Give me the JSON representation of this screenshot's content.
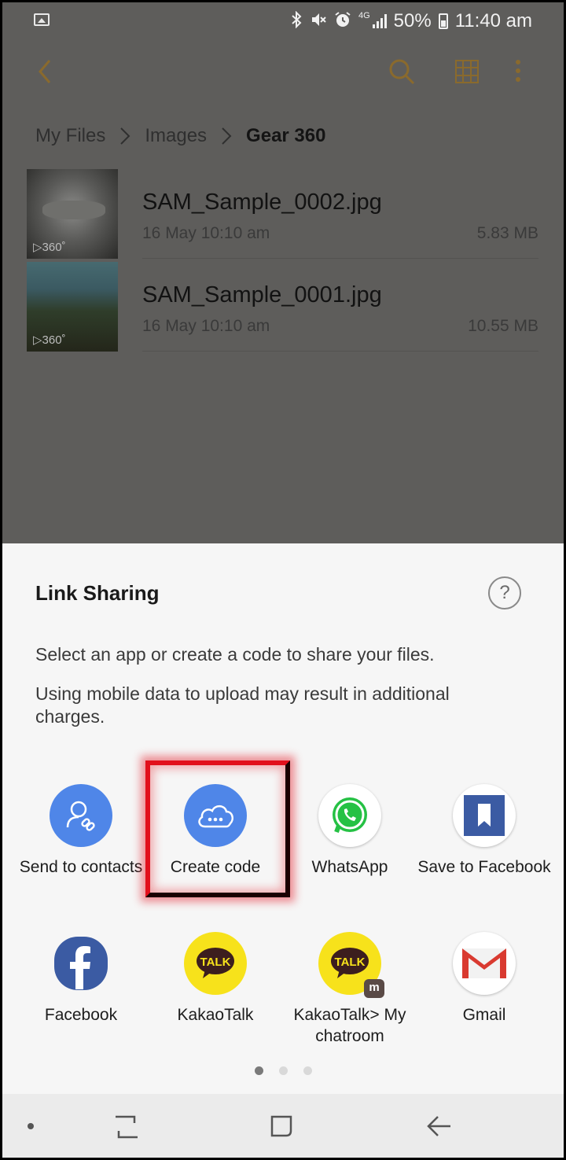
{
  "status_bar": {
    "network_label": "4G",
    "battery": "50%",
    "time": "11:40 am",
    "icons": [
      "gallery-icon",
      "bluetooth-icon",
      "mute-icon",
      "alarm-icon",
      "signal-icon",
      "battery-icon"
    ]
  },
  "app_bar": {
    "icons": [
      "back-arrow-icon",
      "search-icon",
      "grid-view-icon",
      "more-options-icon"
    ],
    "accent_color": "#8a6a2d"
  },
  "breadcrumb": {
    "items": [
      "My Files",
      "Images",
      "Gear 360"
    ]
  },
  "files": [
    {
      "name": "SAM_Sample_0002.jpg",
      "date": "16 May 10:10 am",
      "size": "5.83 MB",
      "badge": "▷360˚"
    },
    {
      "name": "SAM_Sample_0001.jpg",
      "date": "16 May 10:10 am",
      "size": "10.55 MB",
      "badge": "▷360˚"
    }
  ],
  "sheet": {
    "title": "Link Sharing",
    "help_label": "?",
    "description_1": "Select an app or create a code to share your files.",
    "description_2": "Using mobile data to upload may result in additional charges.",
    "apps": [
      {
        "label": "Send to contacts",
        "icon": "contacts-link-icon"
      },
      {
        "label": "Create code",
        "icon": "cloud-code-icon"
      },
      {
        "label": "WhatsApp",
        "icon": "whatsapp-icon"
      },
      {
        "label": "Save to Facebook",
        "icon": "facebook-save-icon"
      },
      {
        "label": "Facebook",
        "icon": "facebook-icon"
      },
      {
        "label": "KakaoTalk",
        "icon": "kakaotalk-icon",
        "icon_text": "TALK"
      },
      {
        "label": "KakaoTalk> My chatroom",
        "icon": "kakaotalk-chatroom-icon",
        "icon_text": "TALK",
        "sub_badge": "m"
      },
      {
        "label": "Gmail",
        "icon": "gmail-icon"
      }
    ],
    "page_dots": {
      "count": 3,
      "active": 0
    }
  },
  "nav_bar": {
    "icons": [
      "dot-icon",
      "recent-apps-icon",
      "home-icon",
      "back-icon"
    ]
  }
}
